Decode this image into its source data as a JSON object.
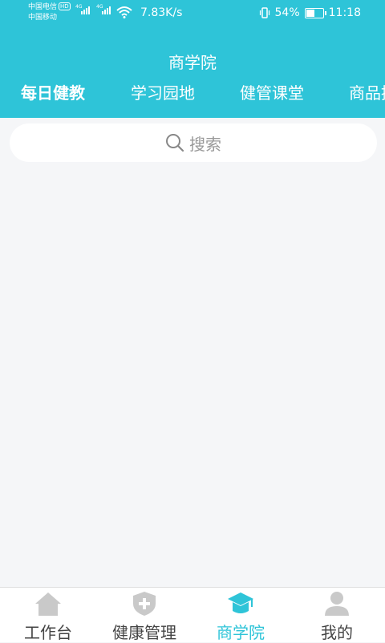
{
  "status_bar": {
    "carrier_1": "中国电信",
    "carrier_1_badge": "HD",
    "carrier_2": "中国移动",
    "signal_tag_1": "4G",
    "signal_tag_2": "4G",
    "net_speed": "7.83K/s",
    "battery": "54%",
    "battery_level": 0.54,
    "time": "11:18"
  },
  "header": {
    "title": "商学院"
  },
  "tabs": [
    {
      "label": "每日健教",
      "active": true
    },
    {
      "label": "学习园地",
      "active": false
    },
    {
      "label": "健管课堂",
      "active": false
    },
    {
      "label": "商品推",
      "active": false
    }
  ],
  "search": {
    "placeholder": "搜索"
  },
  "bottom_nav": [
    {
      "label": "工作台",
      "icon": "home-icon",
      "active": false
    },
    {
      "label": "健康管理",
      "icon": "shield-plus-icon",
      "active": false
    },
    {
      "label": "商学院",
      "icon": "graduation-cap-icon",
      "active": true
    },
    {
      "label": "我的",
      "icon": "user-icon",
      "active": false
    }
  ],
  "colors": {
    "primary": "#2ec4d8",
    "background": "#f5f6f8",
    "inactive_icon": "#c9c9c9",
    "inactive_text": "#444444",
    "placeholder_text": "#999999"
  }
}
